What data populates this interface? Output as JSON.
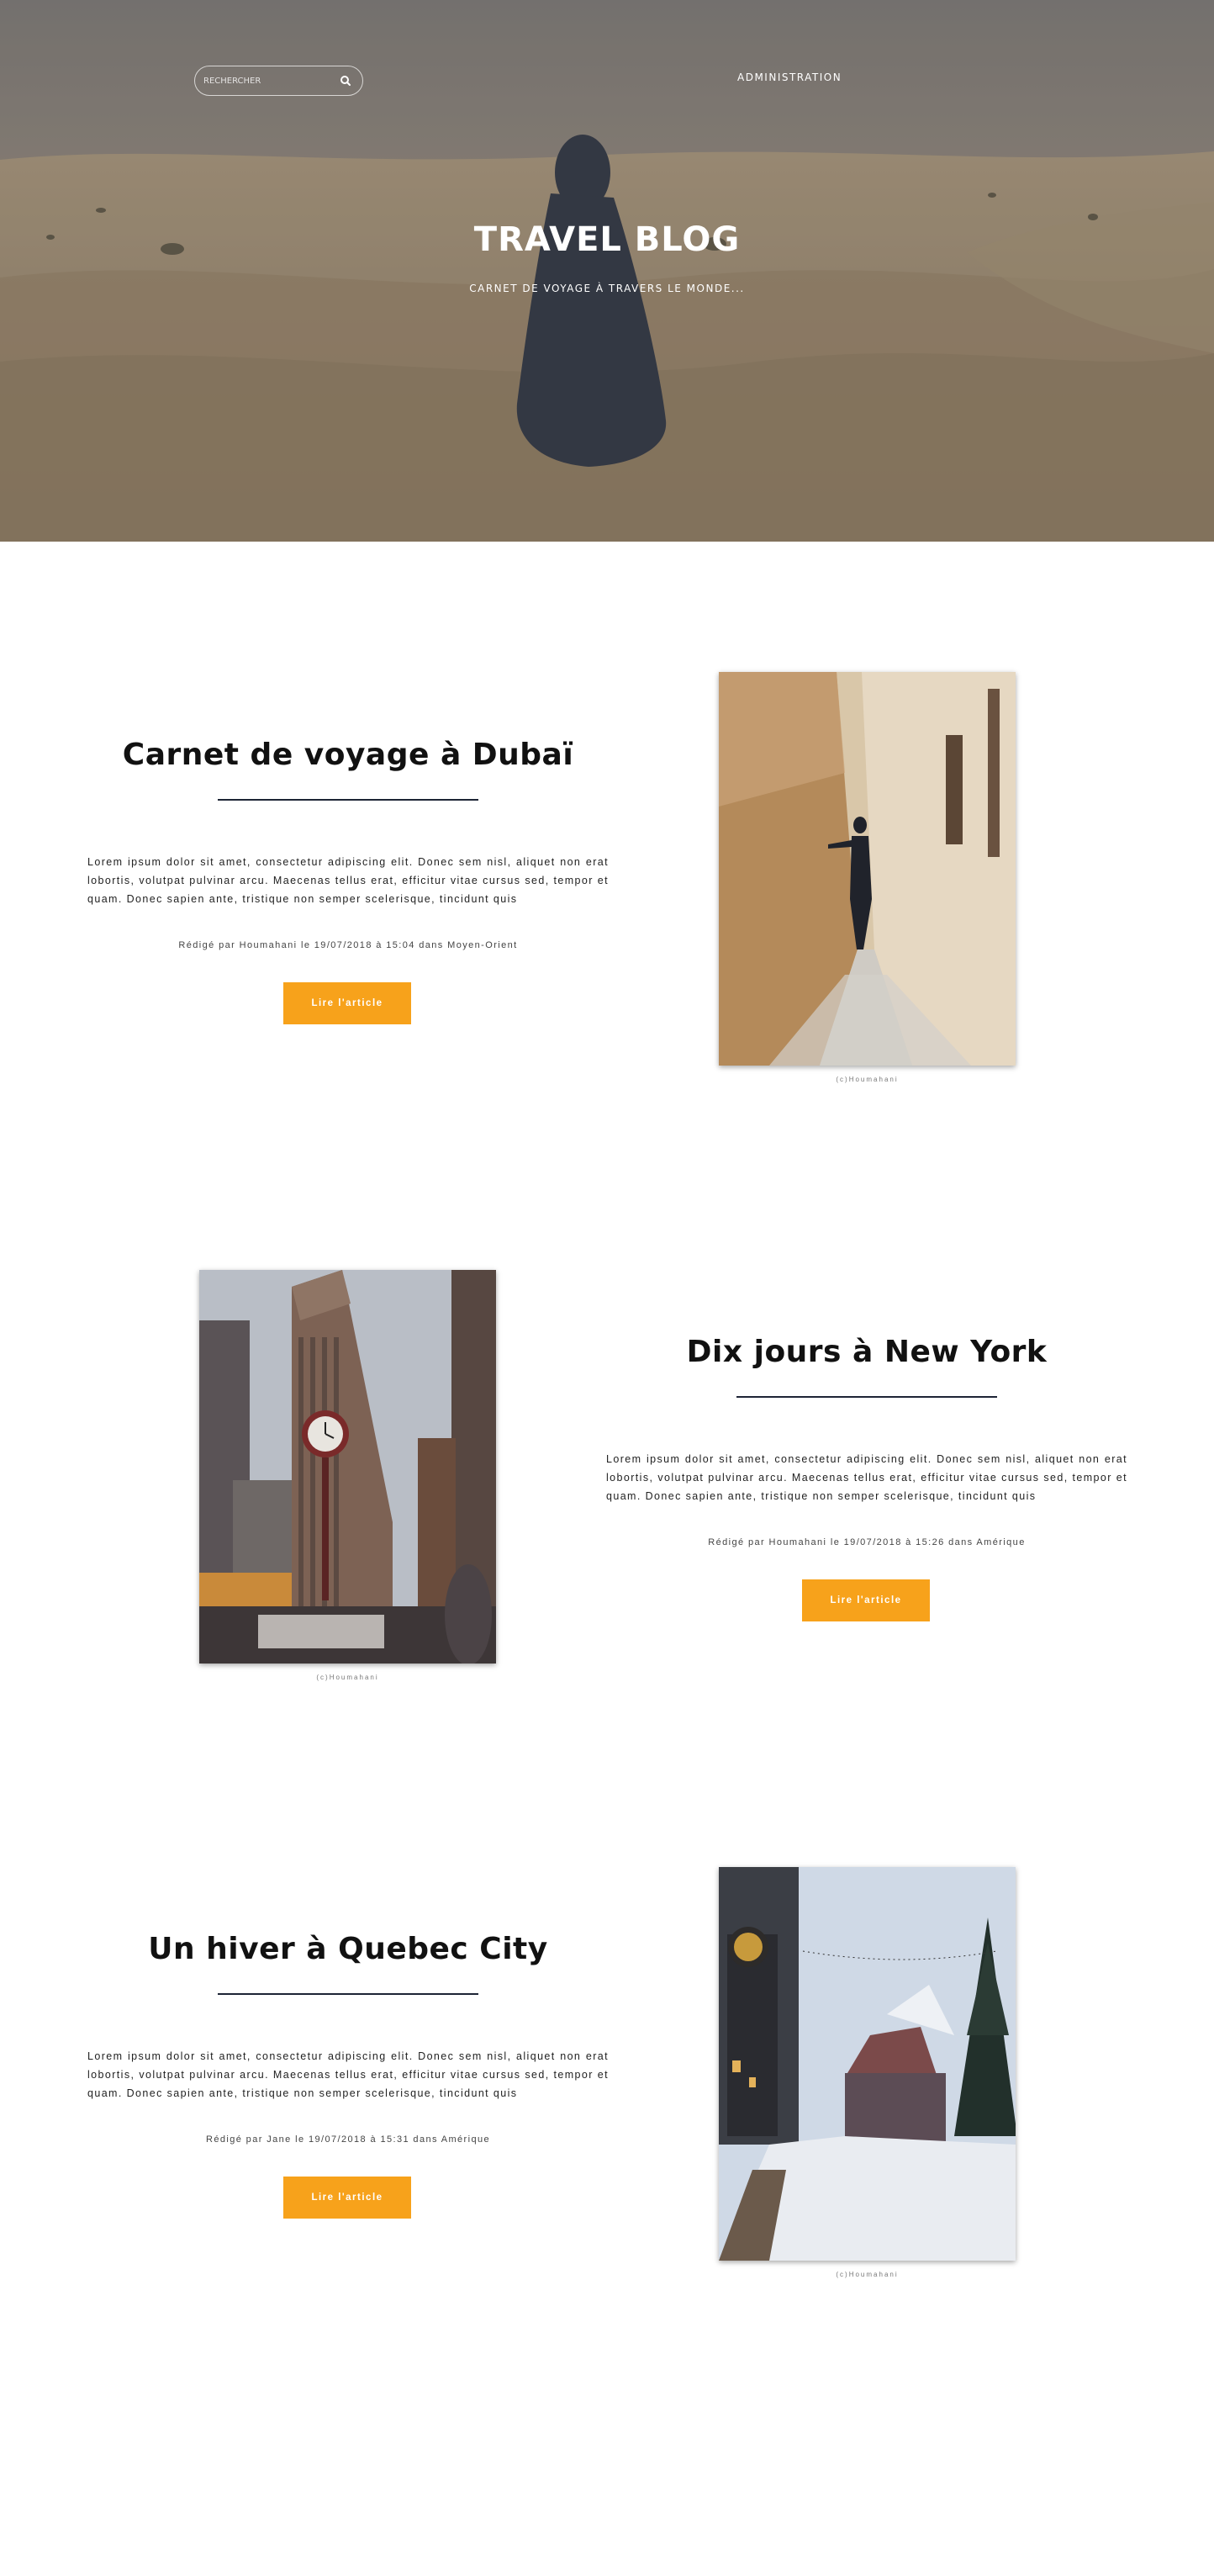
{
  "header": {
    "search_placeholder": "RECHERCHER",
    "admin_label": "ADMINISTRATION",
    "title": "TRAVEL BLOG",
    "subtitle": "CARNET DE VOYAGE À TRAVERS LE MONDE..."
  },
  "articles": [
    {
      "title": "Carnet de voyage à Dubaï",
      "body": "Lorem ipsum dolor sit amet, consectetur adipiscing elit. Donec sem nisl, aliquet non erat lobortis, volutpat pulvinar arcu. Maecenas tellus erat, efficitur vitae cursus sed, tempor et quam. Donec sapien ante, tristique non semper scelerisque, tincidunt quis",
      "meta": "Rédigé par Houmahani le 19/07/2018 à 15:04 dans Moyen-Orient",
      "button": "Lire l'article",
      "caption": "(c)Houmahani"
    },
    {
      "title": "Dix jours à New York",
      "body": "Lorem ipsum dolor sit amet, consectetur adipiscing elit. Donec sem nisl, aliquet non erat lobortis, volutpat pulvinar arcu. Maecenas tellus erat, efficitur vitae cursus sed, tempor et quam. Donec sapien ante, tristique non semper scelerisque, tincidunt quis",
      "meta": "Rédigé par Houmahani le 19/07/2018 à 15:26 dans Amérique",
      "button": "Lire l'article",
      "caption": "(c)Houmahani"
    },
    {
      "title": "Un hiver à Quebec City",
      "body": "Lorem ipsum dolor sit amet, consectetur adipiscing elit. Donec sem nisl, aliquet non erat lobortis, volutpat pulvinar arcu. Maecenas tellus erat, efficitur vitae cursus sed, tempor et quam. Donec sapien ante, tristique non semper scelerisque, tincidunt quis",
      "meta": "Rédigé par Jane le 19/07/2018 à 15:31 dans Amérique",
      "button": "Lire l'article",
      "caption": "(c)Houmahani"
    }
  ],
  "colors": {
    "accent": "#f7a21b",
    "rule": "#1d2435",
    "overlay": "#6b6b6b"
  },
  "icons": {
    "search": "search-icon"
  }
}
